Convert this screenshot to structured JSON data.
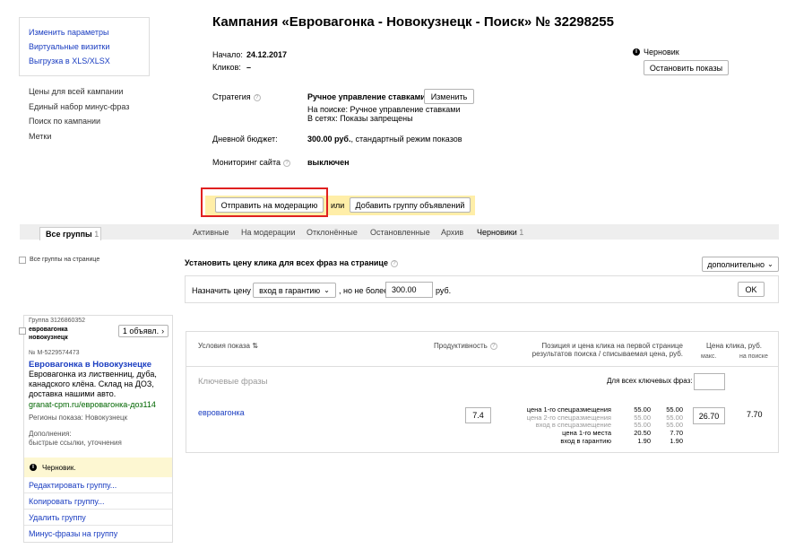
{
  "sidebar": {
    "top_links": [
      "Изменить параметры",
      "Виртуальные визитки",
      "Выгрузка в XLS/XLSX"
    ],
    "bottom_links": [
      "Цены для всей кампании",
      "Единый набор минус-фраз",
      "Поиск по кампании",
      "Метки"
    ]
  },
  "campaign": {
    "title": "Кампания «Евровагонка - Новокузнецк - Поиск» № 32298255",
    "start_label": "Начало:",
    "start_value": "24.12.2017",
    "clicks_label": "Кликов:",
    "clicks_value": "–",
    "status": "Черновик",
    "stop_button": "Остановить показы",
    "strategy_label": "Стратегия",
    "strategy_value": "Ручное управление ставками",
    "strategy_change": "Изменить",
    "strategy_search": "На поиске: Ручное управление ставками",
    "strategy_networks": "В сетях: Показы запрещены",
    "budget_label": "Дневной бюджет:",
    "budget_value": "300.00 руб.",
    "budget_mode": ", стандартный режим показов",
    "monitoring_label": "Мониторинг сайта",
    "monitoring_value": "выключен",
    "moderation_button": "Отправить на модерацию",
    "or_text": "или",
    "add_group_button": "Добавить группу объявлений"
  },
  "tabs": {
    "all_groups": "Все группы",
    "all_groups_count": "1",
    "items": [
      "Активные",
      "На модерации",
      "Отклонённые",
      "Остановленные",
      "Архив"
    ],
    "drafts": "Черновики",
    "drafts_count": "1"
  },
  "controls": {
    "all_groups_on_page": "Все группы на странице",
    "set_price_title": "Установить цену клика для всех фраз на странице",
    "extra_dropdown": "дополнительно",
    "assign_price": "Назначить цену",
    "price_mode": "вход в гарантию",
    "not_more_than": ", но не более",
    "max_price": "300.00",
    "currency": "руб.",
    "ok_button": "OK"
  },
  "group": {
    "group_id": "Группа 3126860352",
    "name_line1": "евровагонка",
    "name_line2": "новокузнецк",
    "ads_button": "1 объявл.",
    "ad_id": "№ M-5229574473",
    "ad_title": "Евровагонка в Новокузнецке",
    "ad_text": "Евровагонка из лиственниц, дуба, канадского клёна. Склад на ДОЗ, доставка нашими авто.",
    "ad_url": "granat-cpm.ru/евровагонка-доз114",
    "regions": "Регионы показа: Новокузнецк",
    "extras_label": "Дополнения:",
    "extras_value": "быстрые ссылки, уточнения",
    "draft_status": "Черновик.",
    "actions": [
      "Редактировать группу...",
      "Копировать группу...",
      "Удалить группу",
      "Минус-фразы на группу"
    ]
  },
  "table": {
    "col_conditions": "Условия показа",
    "col_productivity": "Продуктивность",
    "col_position_line1": "Позиция и цена клика на первой странице",
    "col_position_line2": "результатов поиска / списываемая цена, руб.",
    "col_price": "Цена клика, руб.",
    "col_max": "макс.",
    "col_search": "на поиске",
    "keywords_label": "Ключевые фразы",
    "all_keywords_label": "Для всех ключевых фраз:",
    "keyword": "евровагонка",
    "productivity": "7.4",
    "positions": [
      {
        "label": "цена 1-го спецразмещения",
        "v1": "55.00",
        "v2": "55.00",
        "dim": false
      },
      {
        "label": "цена 2-го спецразмещения",
        "v1": "55.00",
        "v2": "55.00",
        "dim": true
      },
      {
        "label": "вход в спецразмещение",
        "v1": "55.00",
        "v2": "55.00",
        "dim": true
      },
      {
        "label": "цена 1-го места",
        "v1": "20.50",
        "v2": "7.70",
        "dim": false
      },
      {
        "label": "вход в гарантию",
        "v1": "1.90",
        "v2": "1.90",
        "dim": false
      }
    ],
    "max_price": "26.70",
    "search_price": "7.70"
  },
  "colors": {
    "link": "#1a3dc1",
    "highlight": "#ffeea8",
    "draft_bg": "#fdf7d2",
    "tabs_bg": "#eeeeee",
    "red_frame": "#e02020"
  }
}
